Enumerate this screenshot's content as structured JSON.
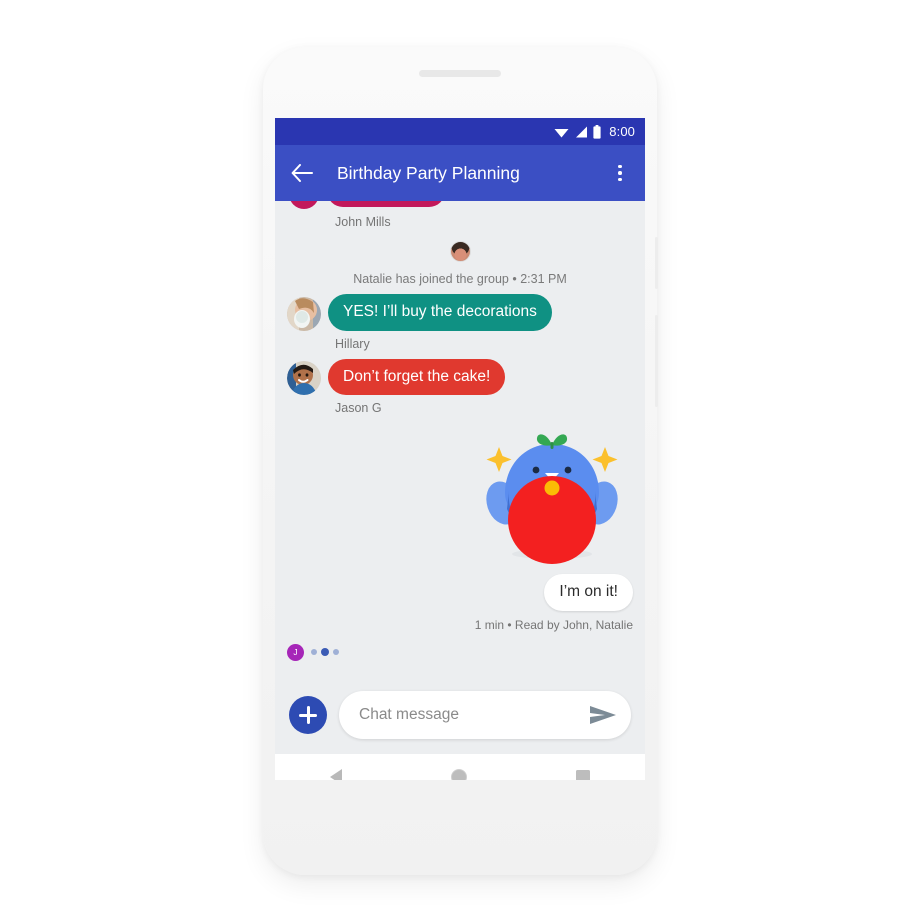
{
  "device": {
    "name": "android-phone-mockup"
  },
  "status_bar": {
    "time": "8:00",
    "icons": [
      "wifi-icon",
      "cell-signal-icon",
      "battery-icon"
    ]
  },
  "app_bar": {
    "back_label": "back-arrow",
    "title": "Birthday Party Planning",
    "overflow_label": "more-options"
  },
  "conversation": {
    "cutoff_sender": "John Mills",
    "join_event": {
      "text": "Natalie has joined the group • 2:31 PM",
      "avatar_name": "natalie-avatar"
    },
    "messages": [
      {
        "sender": "Hillary",
        "text": "YES! I’ll buy the decorations",
        "bubble_color": "#0f9183",
        "side": "in"
      },
      {
        "sender": "Jason G",
        "text": "Don’t forget the cake!",
        "bubble_color": "#e0392f",
        "side": "in"
      }
    ],
    "sticker": {
      "name": "blue-blob-with-red-balloon-sticker",
      "body_color": "#5b8def",
      "balloon_color": "#f32020",
      "leaf_color": "#34a853",
      "dot_color": "#fbbc05",
      "sparkle_color": "#fbc02d"
    },
    "outgoing": {
      "text": "I’m on it!",
      "receipt": "1 min • Read by John, Natalie"
    },
    "typing": {
      "avatar_initial": "J",
      "avatar_color": "#a626b8",
      "dots": 3
    }
  },
  "compose": {
    "add_label": "add-attachment",
    "placeholder": "Chat message",
    "value": "",
    "send_label": "send-message"
  },
  "nav_bar": {
    "back": "nav-back",
    "home": "nav-home",
    "recents": "nav-recents"
  },
  "theme": {
    "status_bar_bg": "#2a36b1",
    "app_bar_bg": "#3b4fc4",
    "screen_bg": "#eceef0",
    "fab_bg": "#2d4bb3"
  }
}
